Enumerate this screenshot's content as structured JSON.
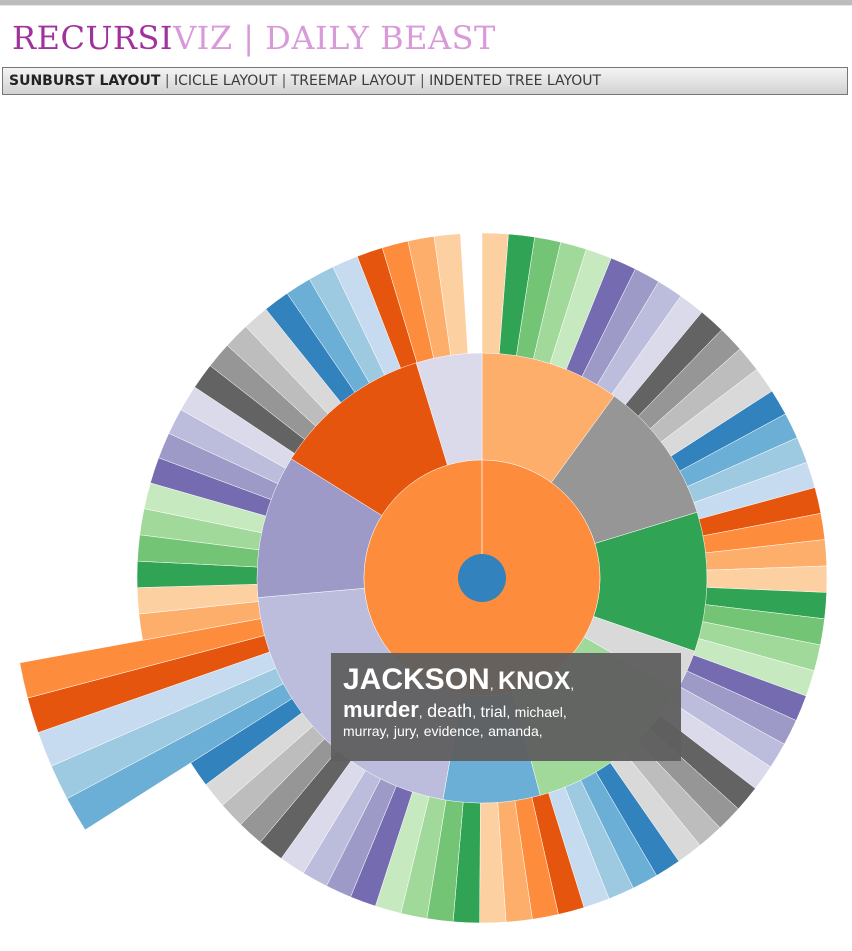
{
  "header": {
    "title_part1": "RECURSI",
    "title_part2": "VIZ | DAILY BEAST"
  },
  "nav": {
    "sunburst": "SUNBURST LAYOUT",
    "icicle": "ICICLE LAYOUT",
    "treemap": "TREEMAP LAYOUT",
    "indented_tree": "INDENTED TREE LAYOUT",
    "separator": "|"
  },
  "tooltip": {
    "words": [
      "JACKSON",
      "KNOX",
      "murder",
      "death",
      "trial",
      "michael",
      "murray",
      "jury",
      "evidence",
      "amanda"
    ],
    "separator": ","
  },
  "colors": {
    "title_primary": "#a0329b",
    "title_secondary": "#d89ad8",
    "center_node": "#3182bd",
    "level1": "#fd8d3c",
    "tooltip_bg": "#5f5f5f"
  },
  "chart_data": {
    "type": "sunburst",
    "center_color": "#3182bd",
    "level1": [
      {
        "start": 0,
        "end": 360,
        "color": "#fd8d3c"
      }
    ],
    "level2": [
      {
        "start": 0,
        "end": 36,
        "color": "#fdae6b"
      },
      {
        "start": 36,
        "end": 73,
        "color": "#969696"
      },
      {
        "start": 73,
        "end": 109,
        "color": "#31a354"
      },
      {
        "start": 109,
        "end": 120,
        "color": "#d9d9d9"
      },
      {
        "start": 120,
        "end": 165,
        "color": "#a1d99b"
      },
      {
        "start": 165,
        "end": 190,
        "color": "#6baed6"
      },
      {
        "start": 190,
        "end": 265,
        "color": "#bcbddc"
      },
      {
        "start": 265,
        "end": 302,
        "color": "#9e9ac8"
      },
      {
        "start": 302,
        "end": 343,
        "color": "#e6550d"
      },
      {
        "start": 343,
        "end": 360,
        "color": "#dadaeb"
      }
    ],
    "outer_palette": [
      "#fdd0a2",
      "#31a354",
      "#74c476",
      "#a1d99b",
      "#c7e9c0",
      "#756bb1",
      "#9e9ac8",
      "#bcbddc",
      "#dadaeb",
      "#636363",
      "#969696",
      "#bdbdbd",
      "#d9d9d9",
      "#3182bd",
      "#6baed6",
      "#9ecae1",
      "#c6dbef",
      "#e6550d",
      "#fd8d3c",
      "#fdae6b"
    ],
    "outer_gap_degrees": [
      352,
      359
    ],
    "highlighted_arc_degrees": [
      236,
      259
    ]
  }
}
